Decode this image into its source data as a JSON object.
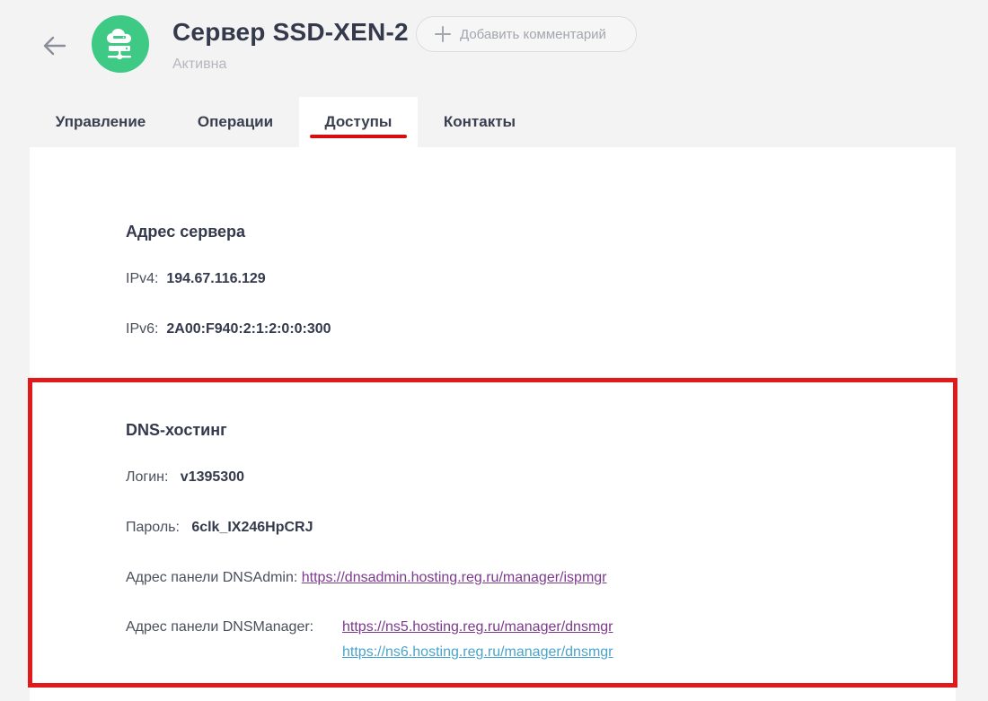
{
  "header": {
    "title": "Сервер SSD-XEN-2",
    "status": "Активна",
    "add_comment_label": "Добавить комментарий"
  },
  "tabs": [
    {
      "label": "Управление",
      "active": false
    },
    {
      "label": "Операции",
      "active": false
    },
    {
      "label": "Доступы",
      "active": true
    },
    {
      "label": "Контакты",
      "active": false
    }
  ],
  "server_address": {
    "heading": "Адрес сервера",
    "ipv4_label": "IPv4:",
    "ipv4_value": "194.67.116.129",
    "ipv6_label": "IPv6:",
    "ipv6_value": "2A00:F940:2:1:2:0:0:300"
  },
  "dns_hosting": {
    "heading": "DNS-хостинг",
    "login_label": "Логин:",
    "login_value": "v1395300",
    "password_label": "Пароль:",
    "password_value": "6clk_IX246HpCRJ",
    "dnsadmin_label": "Адрес панели DNSAdmin:",
    "dnsadmin_url": "https://dnsadmin.hosting.reg.ru/manager/ispmgr",
    "dnsmanager_label": "Адрес панели DNSManager:",
    "dnsmanager_url_1": "https://ns5.hosting.reg.ru/manager/dnsmgr",
    "dnsmanager_url_2": "https://ns6.hosting.reg.ru/manager/dnsmgr"
  },
  "colors": {
    "accent_red": "#d70d12",
    "avatar_green": "#3ec985",
    "link_purple": "#7b3a8c",
    "link_blue": "#4aa4c9"
  },
  "icons": {
    "back": "arrow-left-icon",
    "avatar": "cloud-server-icon",
    "add": "plus-icon"
  }
}
